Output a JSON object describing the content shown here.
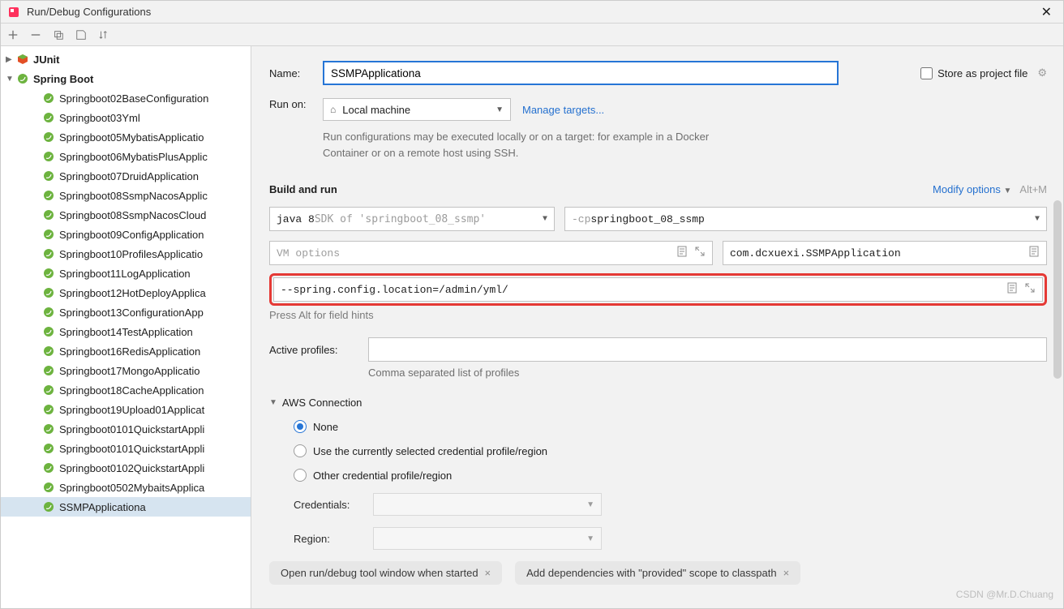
{
  "window": {
    "title": "Run/Debug Configurations"
  },
  "sidebar": {
    "junit": "JUnit",
    "springboot": "Spring Boot",
    "items": [
      "Springboot02BaseConfiguration",
      "Springboot03Yml",
      "Springboot05MybatisApplicatio",
      "Springboot06MybatisPlusApplic",
      "Springboot07DruidApplication",
      "Springboot08SsmpNacosApplic",
      "Springboot08SsmpNacosCloud",
      "Springboot09ConfigApplication",
      "Springboot10ProfilesApplicatio",
      "Springboot11LogApplication",
      "Springboot12HotDeployApplica",
      "Springboot13ConfigurationApp",
      "Springboot14TestApplication",
      "Springboot16RedisApplication",
      "Springboot17MongoApplicatio",
      "Springboot18CacheApplication",
      "Springboot19Upload01Applicat",
      "Springboot0101QuickstartAppli",
      "Springboot0101QuickstartAppli",
      "Springboot0102QuickstartAppli",
      "Springboot0502MybaitsApplica",
      "SSMPApplicationa"
    ]
  },
  "form": {
    "name_label": "Name:",
    "name_value": "SSMPApplicationa",
    "store_label": "Store as project file",
    "runon_label": "Run on:",
    "runon_value": "Local machine",
    "manage_targets": "Manage targets...",
    "runon_hint": "Run configurations may be executed locally or on a target: for example in a Docker Container or on a remote host using SSH."
  },
  "build": {
    "header": "Build and run",
    "modify": "Modify options",
    "shortcut": "Alt+M",
    "sdk_prefix": "java 8 ",
    "sdk_suffix": "SDK of 'springboot_08_ssmp'",
    "cp_prefix": "-cp ",
    "cp_value": "springboot_08_ssmp",
    "vm_placeholder": "VM options",
    "main_class": "com.dcxuexi.SSMPApplication",
    "program_args": "--spring.config.location=/admin/yml/",
    "field_hint": "Press Alt for field hints",
    "profiles_label": "Active profiles:",
    "profiles_hint": "Comma separated list of profiles"
  },
  "aws": {
    "header": "AWS Connection",
    "none": "None",
    "current": "Use the currently selected credential profile/region",
    "other": "Other credential profile/region",
    "credentials_label": "Credentials:",
    "region_label": "Region:"
  },
  "footer": {
    "pill1": "Open run/debug tool window when started",
    "pill2": "Add dependencies with \"provided\" scope to classpath"
  },
  "watermark": "CSDN @Mr.D.Chuang"
}
